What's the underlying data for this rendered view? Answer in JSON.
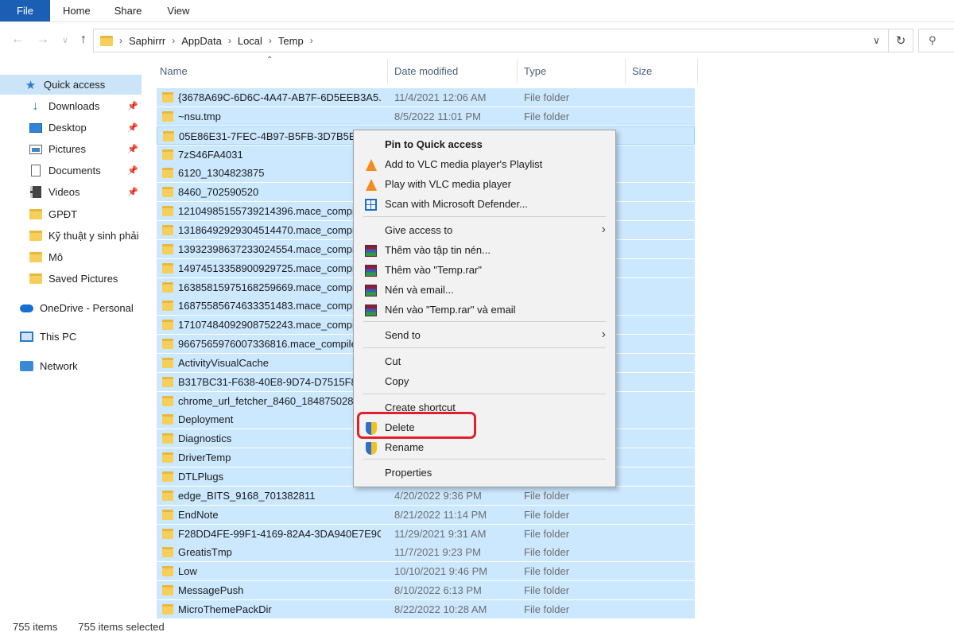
{
  "ribbon": {
    "tabs": [
      "File",
      "Home",
      "Share",
      "View"
    ]
  },
  "address": {
    "crumbs": [
      "Saphirrr",
      "AppData",
      "Local",
      "Temp"
    ]
  },
  "nav": {
    "items": [
      {
        "label": "Quick access",
        "icon": "star-icon",
        "pinned": false
      },
      {
        "label": "Downloads",
        "icon": "download-icon",
        "pinned": true
      },
      {
        "label": "Desktop",
        "icon": "desktop-icon",
        "pinned": true
      },
      {
        "label": "Pictures",
        "icon": "pictures-icon",
        "pinned": true
      },
      {
        "label": "Documents",
        "icon": "documents-icon",
        "pinned": true
      },
      {
        "label": "Videos",
        "icon": "videos-icon",
        "pinned": true
      },
      {
        "label": "GPĐT",
        "icon": "folder-icon",
        "pinned": false
      },
      {
        "label": "Kỹ thuật y sinh phải",
        "icon": "folder-icon",
        "pinned": false
      },
      {
        "label": "Mô",
        "icon": "folder-icon",
        "pinned": false
      },
      {
        "label": "Saved Pictures",
        "icon": "folder-icon",
        "pinned": false
      },
      {
        "label": "OneDrive - Personal",
        "icon": "onedrive-icon",
        "pinned": false
      },
      {
        "label": "This PC",
        "icon": "this-pc-icon",
        "pinned": false
      },
      {
        "label": "Network",
        "icon": "network-icon",
        "pinned": false
      }
    ]
  },
  "columns": {
    "name": "Name",
    "date": "Date modified",
    "type": "Type",
    "size": "Size"
  },
  "files": [
    {
      "name": "{3678A69C-6D6C-4A47-AB7F-6D5EEB3A5...",
      "date": "11/4/2021 12:06 AM",
      "type": "File folder"
    },
    {
      "name": "~nsu.tmp",
      "date": "8/5/2022 11:01 PM",
      "type": "File folder"
    },
    {
      "name": "05E86E31-7FEC-4B97-B5FB-3D7B5B0E",
      "date": "",
      "type": ""
    },
    {
      "name": "7zS46FA4031",
      "date": "",
      "type": ""
    },
    {
      "name": "6120_1304823875",
      "date": "",
      "type": ""
    },
    {
      "name": "8460_702590520",
      "date": "",
      "type": ""
    },
    {
      "name": "12104985155739214396.mace_compil",
      "date": "",
      "type": ""
    },
    {
      "name": "13186492929304514470.mace_compil",
      "date": "",
      "type": ""
    },
    {
      "name": "13932398637233024554.mace_compil",
      "date": "",
      "type": ""
    },
    {
      "name": "14974513358900929725.mace_compil",
      "date": "",
      "type": ""
    },
    {
      "name": "16385815975168259669.mace_compil",
      "date": "",
      "type": ""
    },
    {
      "name": "16875585674633351483.mace_compil",
      "date": "",
      "type": ""
    },
    {
      "name": "17107484092908752243.mace_compil",
      "date": "",
      "type": ""
    },
    {
      "name": "9667565976007336816.mace_compile",
      "date": "",
      "type": ""
    },
    {
      "name": "ActivityVisualCache",
      "date": "",
      "type": ""
    },
    {
      "name": "B317BC31-F638-40E8-9D74-D7515F8E",
      "date": "",
      "type": ""
    },
    {
      "name": "chrome_url_fetcher_8460_1848750281",
      "date": "",
      "type": ""
    },
    {
      "name": "Deployment",
      "date": "",
      "type": ""
    },
    {
      "name": "Diagnostics",
      "date": "",
      "type": ""
    },
    {
      "name": "DriverTemp",
      "date": "",
      "type": ""
    },
    {
      "name": "DTLPlugs",
      "date": "",
      "type": ""
    },
    {
      "name": "edge_BITS_9168_701382811",
      "date": "4/20/2022 9:36 PM",
      "type": "File folder"
    },
    {
      "name": "EndNote",
      "date": "8/21/2022 11:14 PM",
      "type": "File folder"
    },
    {
      "name": "F28DD4FE-99F1-4169-82A4-3DA940E7E9CF",
      "date": "11/29/2021 9:31 AM",
      "type": "File folder"
    },
    {
      "name": "GreatisTmp",
      "date": "11/7/2021 9:23 PM",
      "type": "File folder"
    },
    {
      "name": "Low",
      "date": "10/10/2021 9:46 PM",
      "type": "File folder"
    },
    {
      "name": "MessagePush",
      "date": "8/10/2022 6:13 PM",
      "type": "File folder"
    },
    {
      "name": "MicroThemePackDir",
      "date": "8/22/2022 10:28 AM",
      "type": "File folder"
    }
  ],
  "context_menu": {
    "items": [
      {
        "label": "Pin to Quick access",
        "bold": true,
        "icon": "",
        "arrow": false
      },
      {
        "label": "Add to VLC media player's Playlist",
        "icon": "vlc-icon",
        "arrow": false
      },
      {
        "label": "Play with VLC media player",
        "icon": "vlc-icon",
        "arrow": false
      },
      {
        "label": "Scan with Microsoft Defender...",
        "icon": "defender-icon",
        "arrow": false
      },
      {
        "label": "Give access to",
        "icon": "",
        "arrow": true
      },
      {
        "label": "Thêm vào tập tin nén...",
        "icon": "winrar-icon",
        "arrow": false
      },
      {
        "label": "Thêm vào \"Temp.rar\"",
        "icon": "winrar-icon",
        "arrow": false
      },
      {
        "label": "Nén và email...",
        "icon": "winrar-icon",
        "arrow": false
      },
      {
        "label": "Nén vào \"Temp.rar\" và email",
        "icon": "winrar-icon",
        "arrow": false
      },
      {
        "label": "Send to",
        "icon": "",
        "arrow": true
      },
      {
        "label": "Cut",
        "icon": "",
        "arrow": false
      },
      {
        "label": "Copy",
        "icon": "",
        "arrow": false
      },
      {
        "label": "Create shortcut",
        "icon": "",
        "arrow": false
      },
      {
        "label": "Delete",
        "icon": "uac-shield-icon",
        "arrow": false
      },
      {
        "label": "Rename",
        "icon": "uac-shield-icon",
        "arrow": false
      },
      {
        "label": "Properties",
        "icon": "",
        "arrow": false
      }
    ]
  },
  "status": {
    "items": "755 items",
    "selected": "755 items selected"
  },
  "colors": {
    "selection": "#cce8ff",
    "file_tab": "#1a5fb4",
    "highlight": "#e0202e"
  }
}
